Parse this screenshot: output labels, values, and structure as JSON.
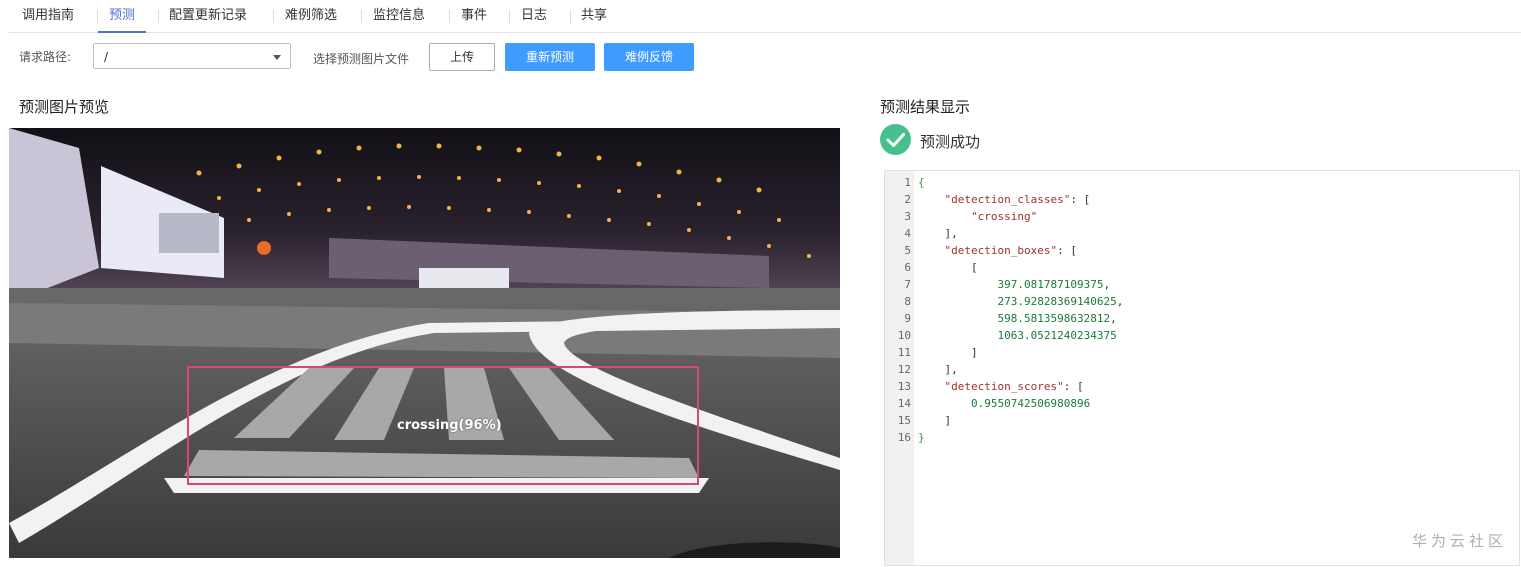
{
  "tabs": [
    {
      "label": "调用指南",
      "active": false
    },
    {
      "label": "预测",
      "active": true
    },
    {
      "label": "配置更新记录",
      "active": false
    },
    {
      "label": "难例筛选",
      "active": false
    },
    {
      "label": "监控信息",
      "active": false
    },
    {
      "label": "事件",
      "active": false
    },
    {
      "label": "日志",
      "active": false
    },
    {
      "label": "共享",
      "active": false
    }
  ],
  "toolbar": {
    "path_label": "请求路径:",
    "path_value": "/",
    "file_label": "选择预测图片文件",
    "upload_button": "上传",
    "repredict_button": "重新预测",
    "hard_example_button": "难例反馈"
  },
  "preview": {
    "title": "预测图片预览",
    "detection_label": "crossing(96%)",
    "box_color": "#d9477a"
  },
  "result": {
    "title": "预测结果显示",
    "status": "预测成功",
    "status_color": "#47c08c",
    "code_lines": [
      "{",
      "    \"detection_classes\": [",
      "        \"crossing\"",
      "    ],",
      "    \"detection_boxes\": [",
      "        [",
      "            397.081787109375,",
      "            273.92828369140625,",
      "            598.5813598632812,",
      "            1063.0521240234375",
      "        ]",
      "    ],",
      "    \"detection_scores\": [",
      "        0.9550742506980896",
      "    ]",
      "}"
    ]
  },
  "watermark": "华为云社区"
}
